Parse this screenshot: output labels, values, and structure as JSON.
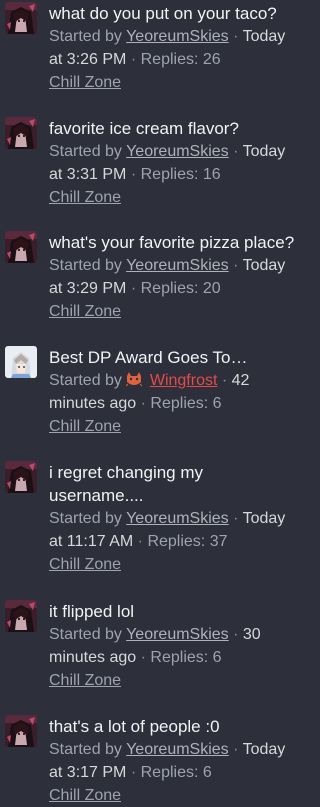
{
  "threads": [
    {
      "title": "what do you put on your taco?",
      "started_by": "Started by",
      "author": "YeoreumSkies",
      "time": "Today at 3:26 PM",
      "replies": "Replies: 26",
      "forum": "Chill Zone",
      "avatar": "dark-anime-avatar"
    },
    {
      "title": "favorite ice cream flavor?",
      "started_by": "Started by",
      "author": "YeoreumSkies",
      "time": "Today at 3:31 PM",
      "replies": "Replies: 16",
      "forum": "Chill Zone",
      "avatar": "dark-anime-avatar"
    },
    {
      "title": "what's your favorite pizza place?",
      "started_by": "Started by",
      "author": "YeoreumSkies",
      "time": "Today at 3:29 PM",
      "replies": "Replies: 20",
      "forum": "Chill Zone",
      "avatar": "dark-anime-avatar"
    },
    {
      "title": "Best DP Award Goes To…",
      "started_by": "Started by",
      "author": "Wingfrost",
      "time": "42 minutes ago",
      "replies": "Replies: 6",
      "forum": "Chill Zone",
      "avatar": "light-anime-avatar",
      "author_color": "#e34b4b",
      "author_badge": "cat-badge-icon"
    },
    {
      "title": "i regret changing my username....",
      "started_by": "Started by",
      "author": "YeoreumSkies",
      "time": "Today at 11:17 AM",
      "replies": "Replies: 37",
      "forum": "Chill Zone",
      "avatar": "dark-anime-avatar"
    },
    {
      "title": "it flipped lol",
      "started_by": "Started by",
      "author": "YeoreumSkies",
      "time": "30 minutes ago",
      "replies": "Replies: 6",
      "forum": "Chill Zone",
      "avatar": "dark-anime-avatar"
    },
    {
      "title": "that's a lot of people :0",
      "started_by": "Started by",
      "author": "YeoreumSkies",
      "time": "Today at 3:17 PM",
      "replies": "Replies: 6",
      "forum": "Chill Zone",
      "avatar": "dark-anime-avatar"
    }
  ],
  "separator": "·",
  "colors": {
    "background": "#2d2f3a",
    "title": "#f2f3f5",
    "meta": "#9ea3ad",
    "author_highlight": "#e34b4b"
  }
}
